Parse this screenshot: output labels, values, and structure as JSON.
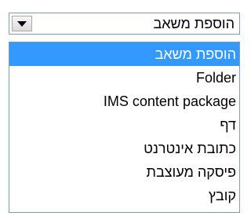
{
  "select": {
    "value": "הוספת משאב",
    "button_icon": "chevron-down-icon"
  },
  "dropdown": {
    "options": [
      {
        "label": "הוספת משאב",
        "selected": true
      },
      {
        "label": "Folder",
        "selected": false
      },
      {
        "label": "IMS content package",
        "selected": false
      },
      {
        "label": "דף",
        "selected": false
      },
      {
        "label": "כתובת אינטרנט",
        "selected": false
      },
      {
        "label": "פיסקה מעוצבת",
        "selected": false
      },
      {
        "label": "קובץ",
        "selected": false
      }
    ]
  },
  "colors": {
    "highlight": "#3399ff",
    "highlight_text": "#ffffff",
    "border": "#7f9db9"
  }
}
